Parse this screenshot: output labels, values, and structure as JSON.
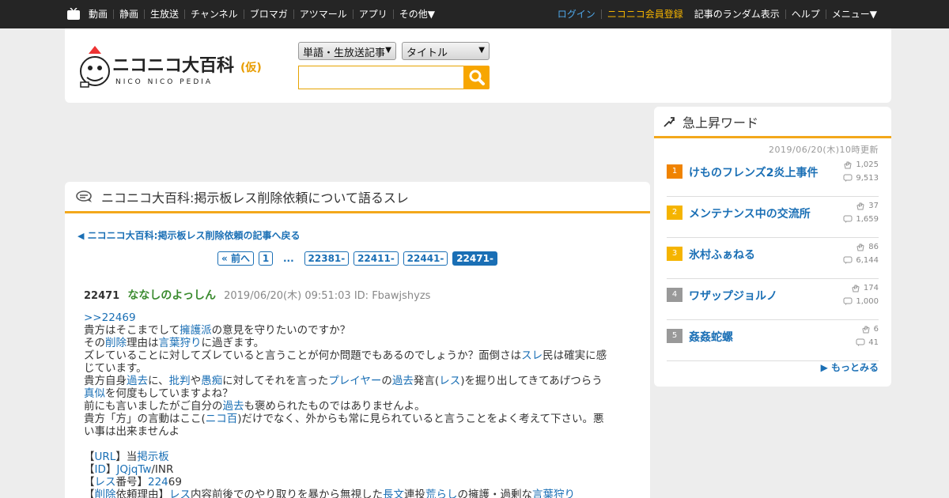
{
  "topbar": {
    "nav_left": [
      "動画",
      "静画",
      "生放送",
      "チャンネル",
      "ブロマガ",
      "アツマール",
      "アプリ",
      "その他▼"
    ],
    "login": "ログイン",
    "register": "ニコニコ会員登録",
    "nav_right": [
      "記事のランダム表示",
      "ヘルプ",
      "メニュー▼"
    ]
  },
  "header": {
    "logo_main": "ニコニコ大百科",
    "logo_kari": "(仮)",
    "logo_sub": "NICO NICO PEDIA",
    "search_type": "単語・生放送記事",
    "search_field": "タイトル",
    "search_value": ""
  },
  "article": {
    "title": "ニコニコ大百科:掲示板レス削除依頼について語るスレ",
    "back_link": "ニコニコ大百科:掲示板レス削除依頼の記事へ戻る",
    "pager": {
      "prev": "« 前へ",
      "first": "1",
      "dots": "...",
      "pages": [
        "22381-",
        "22411-",
        "22441-",
        "22471-"
      ]
    }
  },
  "res": {
    "number": "22471",
    "name": "ななしのよっしん",
    "date": "2019/06/20(木) 09:51:03 ID: Fbawjshyzs",
    "lines": [
      [
        {
          "t": ">>22469",
          "l": true
        }
      ],
      [
        {
          "t": "貴方はそこまでして"
        },
        {
          "t": "擁護派",
          "l": true
        },
        {
          "t": "の意見を守りたいのですか？"
        }
      ],
      [
        {
          "t": "その"
        },
        {
          "t": "削除",
          "l": true
        },
        {
          "t": "理由は"
        },
        {
          "t": "言葉狩り",
          "l": true
        },
        {
          "t": "に過ぎます。"
        }
      ],
      [
        {
          "t": "ズレていることに対してズレていると言うことが何か問題でもあるのでしょうか？面倒さは"
        },
        {
          "t": "スレ",
          "l": true
        },
        {
          "t": "民は確実に感"
        }
      ],
      [
        {
          "t": "じています。"
        }
      ],
      [
        {
          "t": "貴方自身"
        },
        {
          "t": "過去",
          "l": true
        },
        {
          "t": "に、"
        },
        {
          "t": "批判",
          "l": true
        },
        {
          "t": "や"
        },
        {
          "t": "愚痴",
          "l": true
        },
        {
          "t": "に対してそれを言った"
        },
        {
          "t": "プレイヤー",
          "l": true
        },
        {
          "t": "の"
        },
        {
          "t": "過去",
          "l": true
        },
        {
          "t": "発言("
        },
        {
          "t": "レス",
          "l": true
        },
        {
          "t": ")を掘り出してきてあげつらう"
        }
      ],
      [
        {
          "t": "真似",
          "l": true
        },
        {
          "t": "を何度もしていますよね？"
        }
      ],
      [
        {
          "t": "前にも言いましたがご自分の"
        },
        {
          "t": "過去",
          "l": true
        },
        {
          "t": "も褒められたものではありませんよ。"
        }
      ],
      [
        {
          "t": "貴方「方」の言動はここ("
        },
        {
          "t": "ニコ百",
          "l": true
        },
        {
          "t": ")だけでなく、外からも常に見られていると言うことをよく考えて下さい。悪"
        }
      ],
      [
        {
          "t": "い事は出来ませんよ"
        }
      ],
      [],
      [
        {
          "t": "【"
        },
        {
          "t": "URL",
          "l": true
        },
        {
          "t": "】当"
        },
        {
          "t": "掲示板",
          "l": true
        }
      ],
      [
        {
          "t": "【"
        },
        {
          "t": "ID",
          "l": true
        },
        {
          "t": "】"
        },
        {
          "t": "JQjqTw",
          "l": true
        },
        {
          "t": "/INR"
        }
      ],
      [
        {
          "t": "【"
        },
        {
          "t": "レス",
          "l": true
        },
        {
          "t": "番号】"
        },
        {
          "t": "224",
          "l": true
        },
        {
          "t": "69"
        }
      ],
      [
        {
          "t": "【"
        },
        {
          "t": "削除",
          "l": true
        },
        {
          "t": "依頼理由】"
        },
        {
          "t": "レス",
          "l": true
        },
        {
          "t": "内容前後でのやり取りを暴から無視した"
        },
        {
          "t": "長文",
          "l": true
        },
        {
          "t": "連投"
        },
        {
          "t": "荒らし",
          "l": true
        },
        {
          "t": "の擁護・過剰な"
        },
        {
          "t": "言葉狩り",
          "l": true
        }
      ]
    ]
  },
  "sidebar": {
    "title": "急上昇ワード",
    "updated": "2019/06/20(木)10時更新",
    "more": "もっとみる",
    "items": [
      {
        "rank": "1",
        "label": "けものフレンズ2炎上事件",
        "hits": "1,025",
        "comments": "9,513",
        "color": "#f08300"
      },
      {
        "rank": "2",
        "label": "メンテナンス中の交流所",
        "hits": "37",
        "comments": "1,659",
        "color": "#f5b400"
      },
      {
        "rank": "3",
        "label": "氷村ふぁねる",
        "hits": "86",
        "comments": "6,144",
        "color": "#f5b400"
      },
      {
        "rank": "4",
        "label": "ワザップジョルノ",
        "hits": "174",
        "comments": "1,000",
        "color": "#999999"
      },
      {
        "rank": "5",
        "label": "姦姦蛇螺",
        "hits": "6",
        "comments": "41",
        "color": "#999999"
      }
    ]
  },
  "colors": {
    "accent": "#f3a81b",
    "link": "#1a6fb5",
    "name": "#3a8a2e"
  }
}
